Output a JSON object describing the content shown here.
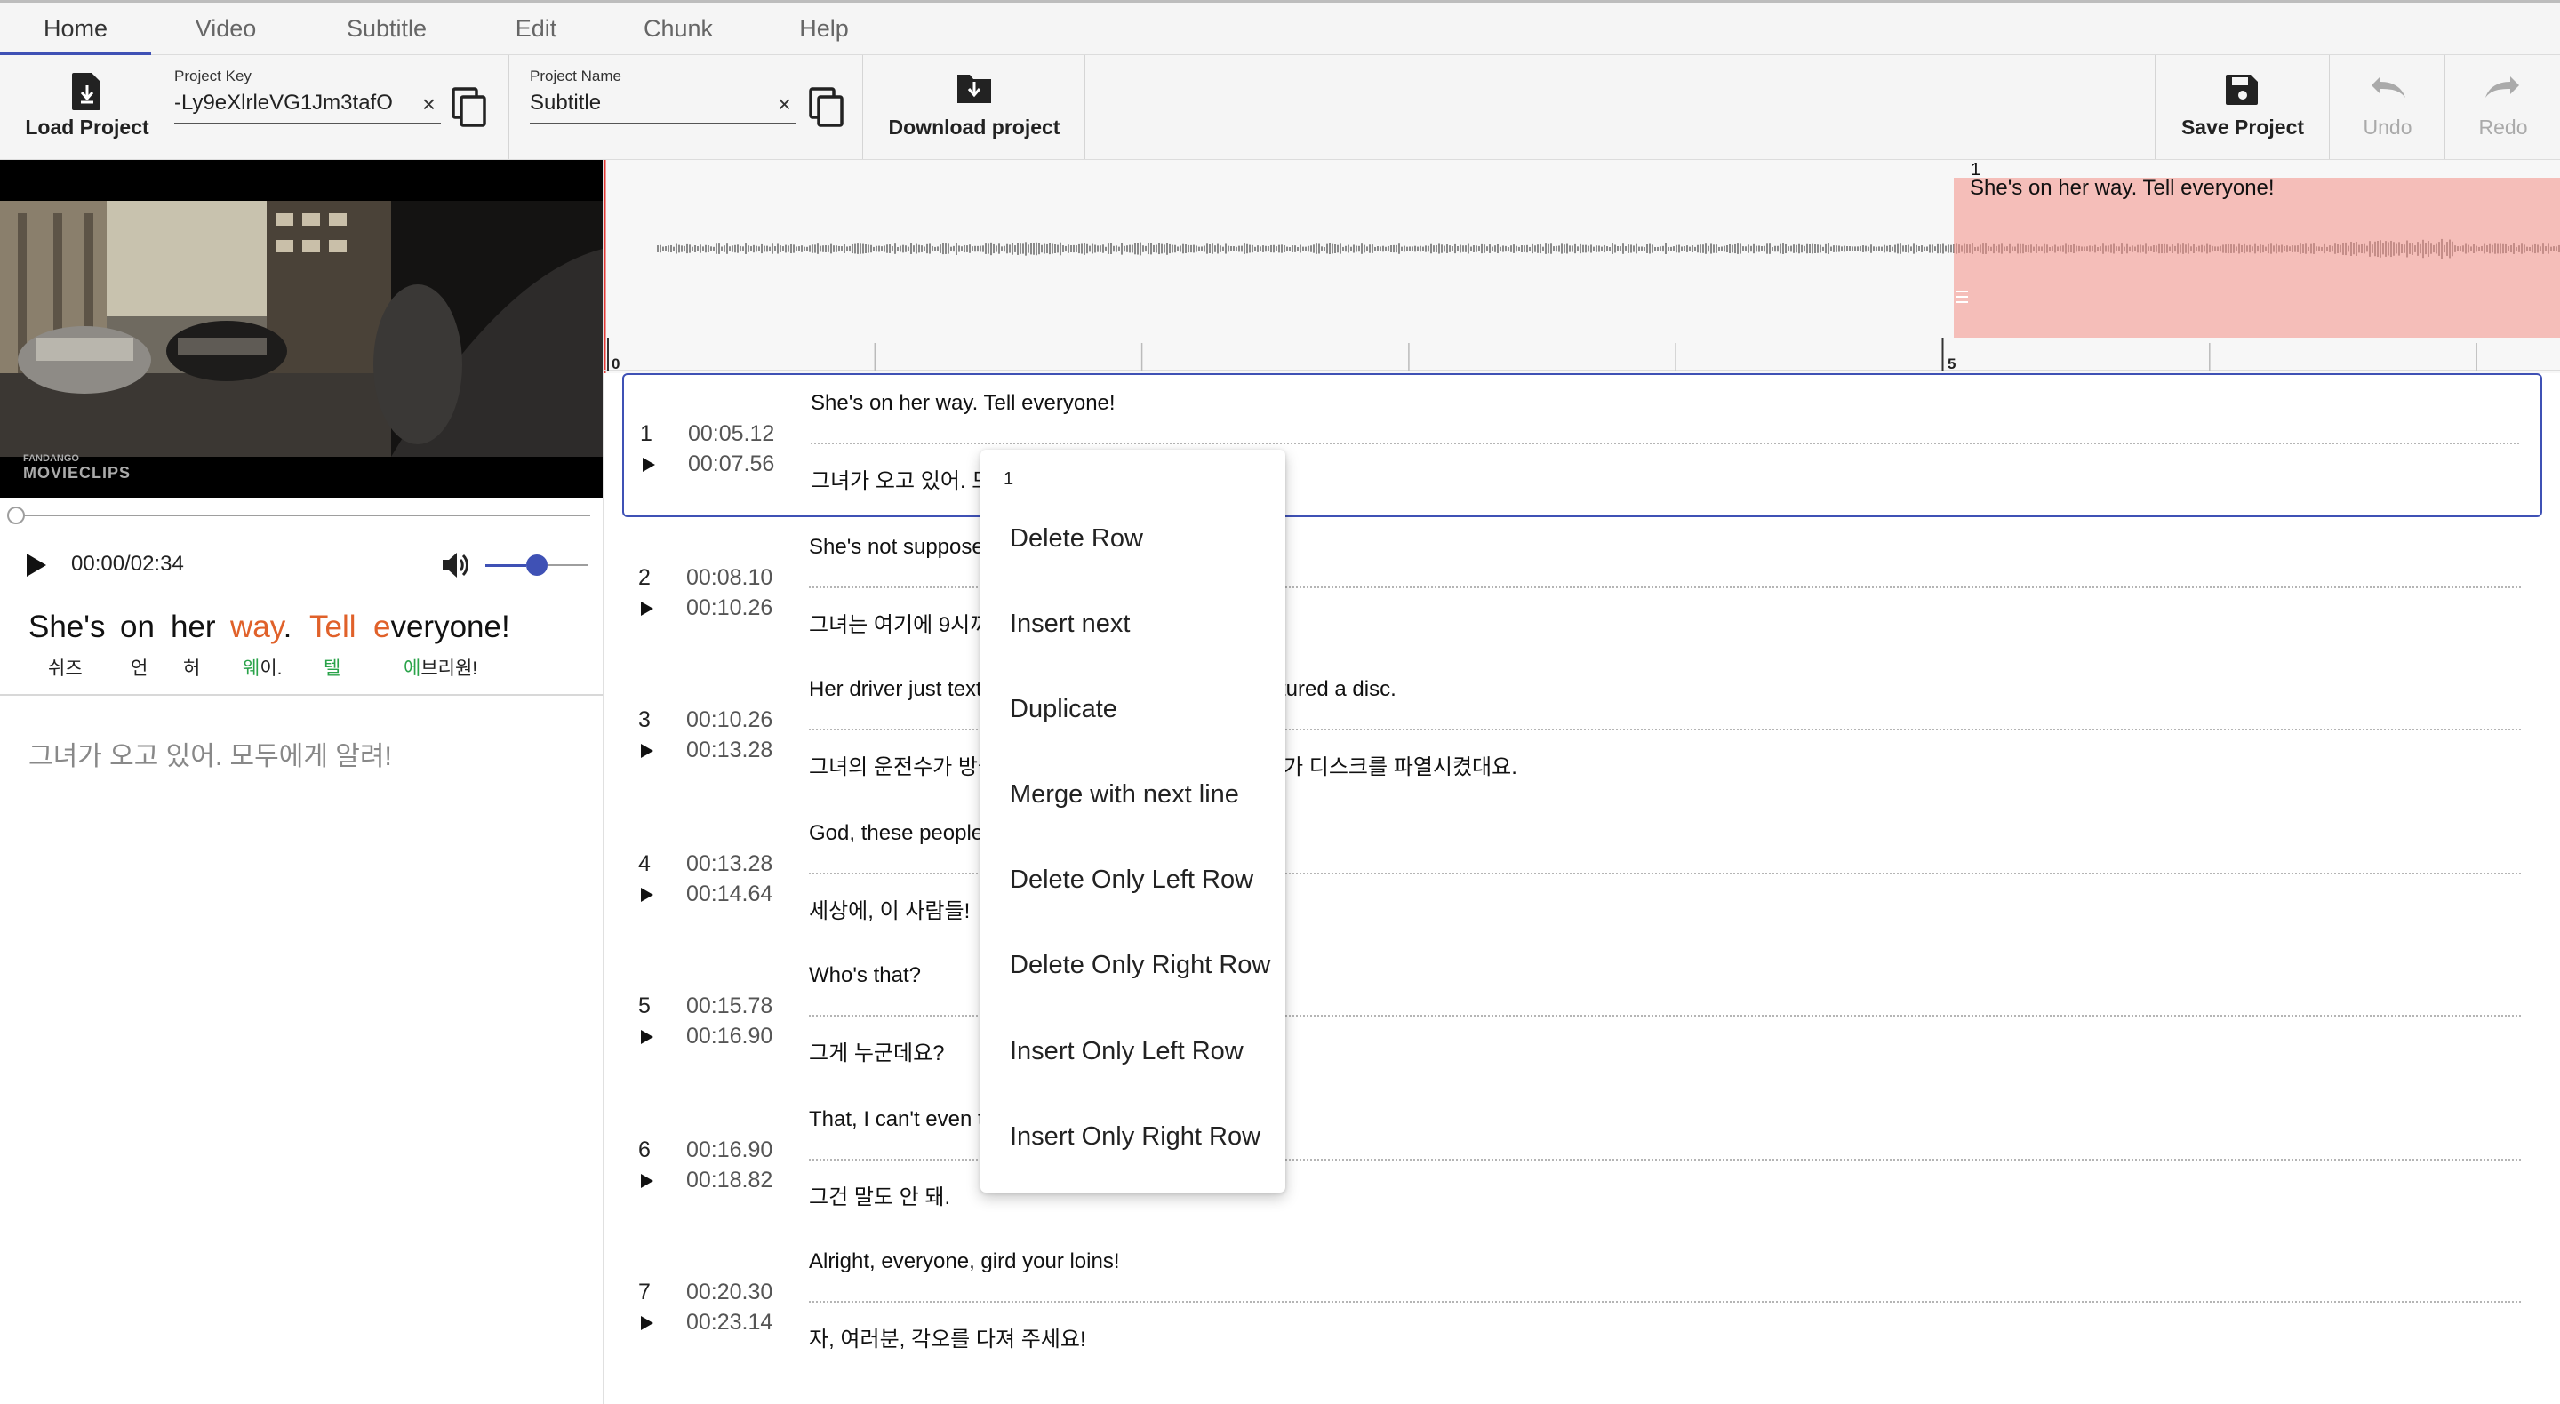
{
  "menu": {
    "tabs": [
      {
        "label": "Home",
        "active": true
      },
      {
        "label": "Video",
        "active": false
      },
      {
        "label": "Subtitle",
        "active": false
      },
      {
        "label": "Edit",
        "active": false
      },
      {
        "label": "Chunk",
        "active": false
      },
      {
        "label": "Help",
        "active": false
      }
    ]
  },
  "toolbar": {
    "load_label": "Load Project",
    "project_key_label": "Project Key",
    "project_key_value": "-Ly9eXlrleVG1Jm3tafO",
    "project_name_label": "Project Name",
    "project_name_value": "Subtitle",
    "download_label": "Download project",
    "save_label": "Save Project",
    "undo_label": "Undo",
    "redo_label": "Redo",
    "clear_glyph": "×"
  },
  "player": {
    "time": "00:00/02:34",
    "progress": 0,
    "volume": 0.5,
    "watermark_top": "FANDANGO",
    "watermark_bottom": "MOVIECLIPS"
  },
  "karaoke": {
    "words": [
      {
        "pre": "She's",
        "hl": "",
        "post": "",
        "reading_pre": "쉬즈",
        "reading_hl": ""
      },
      {
        "pre": "on",
        "hl": "",
        "post": "",
        "reading_pre": "언",
        "reading_hl": ""
      },
      {
        "pre": "her",
        "hl": "",
        "post": "",
        "reading_pre": "허",
        "reading_hl": ""
      },
      {
        "pre": "",
        "hl": "way",
        "post": ".",
        "reading_pre": "",
        "reading_hl": "웨",
        "reading_post": "이."
      },
      {
        "pre": "",
        "hl": "Tell",
        "post": "",
        "reading_pre": "",
        "reading_hl": "텔"
      },
      {
        "pre": "",
        "hl": "e",
        "post": "veryone!",
        "reading_pre": "",
        "reading_hl": "에",
        "reading_post": "브리원!"
      }
    ],
    "translation": "그녀가 오고 있어. 모두에게 알려!"
  },
  "waveform": {
    "region_index": "1",
    "region_text": "She's on her way. Tell everyone!",
    "ruler_labels": [
      "0",
      "5"
    ]
  },
  "rows": [
    {
      "index": "1",
      "start": "00:05.12",
      "end": "00:07.56",
      "source": "She's on her way. Tell everyone!",
      "source_right": "",
      "target": "그녀가 오고 있어. 모",
      "target_right": ""
    },
    {
      "index": "2",
      "start": "00:08.10",
      "end": "00:10.26",
      "source": "She's not suppose",
      "source_right": "",
      "target": "그녀는 여기에 9시까",
      "target_right": ""
    },
    {
      "index": "3",
      "start": "00:10.26",
      "end": "00:13.28",
      "source": "Her driver just text",
      "source_right": "tured a disc.",
      "target": "그녀의 운전수가 방금",
      "target_right": "가 디스크를 파열시켰대요."
    },
    {
      "index": "4",
      "start": "00:13.28",
      "end": "00:14.64",
      "source": "God, these people!",
      "source_right": "",
      "target": "세상에, 이 사람들!",
      "target_right": ""
    },
    {
      "index": "5",
      "start": "00:15.78",
      "end": "00:16.90",
      "source": "Who's that?",
      "source_right": "",
      "target": "그게 누군데요?",
      "target_right": ""
    },
    {
      "index": "6",
      "start": "00:16.90",
      "end": "00:18.82",
      "source": "That, I can't even t",
      "source_right": "",
      "target": "그건 말도 안 돼.",
      "target_right": ""
    },
    {
      "index": "7",
      "start": "00:20.30",
      "end": "00:23.14",
      "source": "Alright, everyone, gird your loins!",
      "source_right": "",
      "target": "자, 여러분, 각오를 다져 주세요!",
      "target_right": ""
    }
  ],
  "context_menu": {
    "row_index": "1",
    "items": [
      "Delete Row",
      "Insert next",
      "Duplicate",
      "Merge with next line",
      "Delete Only Left Row",
      "Delete Only Right Row",
      "Insert Only Left Row",
      "Insert Only Right Row"
    ]
  },
  "colors": {
    "accent": "#3f51b5",
    "highlight_word": "#e0612a",
    "highlight_reading": "#2aa34a",
    "region": "#f48f87"
  }
}
